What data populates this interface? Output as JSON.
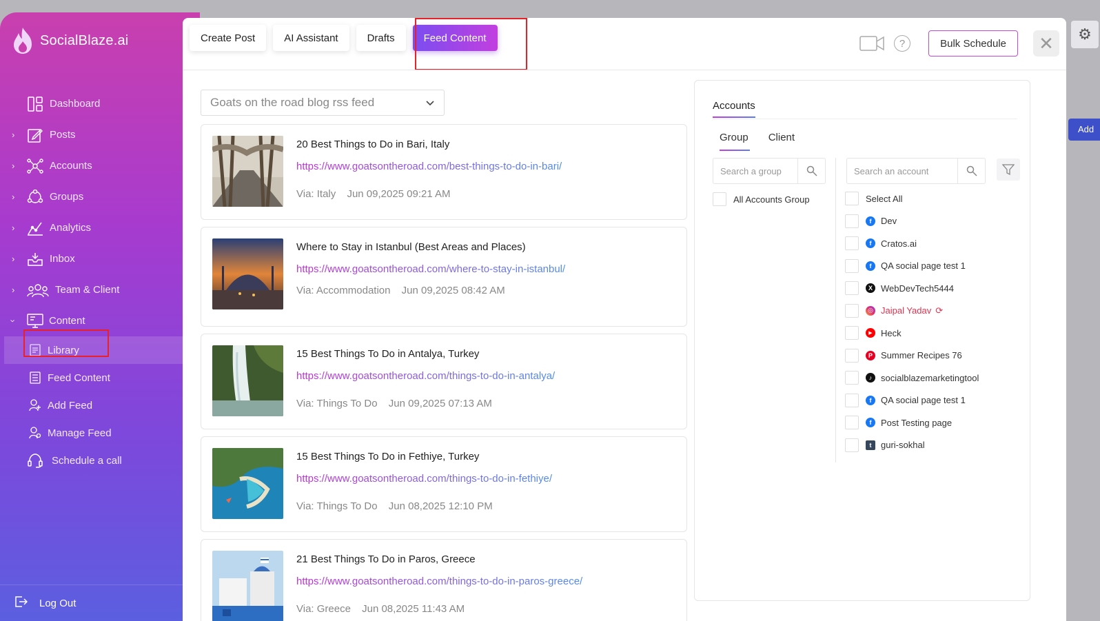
{
  "app": {
    "name": "SocialBlaze.ai"
  },
  "background": {
    "add_label": "Add"
  },
  "sidebar": {
    "items": [
      {
        "label": "Dashboard",
        "icon": "dashboard-icon",
        "chevron": false
      },
      {
        "label": "Posts",
        "icon": "edit-icon",
        "chevron": true
      },
      {
        "label": "Accounts",
        "icon": "network-icon",
        "chevron": true
      },
      {
        "label": "Groups",
        "icon": "groups-icon",
        "chevron": true
      },
      {
        "label": "Analytics",
        "icon": "analytics-icon",
        "chevron": true
      },
      {
        "label": "Inbox",
        "icon": "inbox-icon",
        "chevron": true
      },
      {
        "label": "Team & Client",
        "icon": "team-icon",
        "chevron": true
      },
      {
        "label": "Content",
        "icon": "content-icon",
        "chevron": true,
        "expanded": true
      }
    ],
    "sub_items": [
      {
        "label": "Library",
        "icon": "library-icon",
        "active": true
      },
      {
        "label": "Feed Content",
        "icon": "feed-icon"
      },
      {
        "label": "Add Feed",
        "icon": "add-user-icon"
      },
      {
        "label": "Manage Feed",
        "icon": "manage-feed-icon"
      },
      {
        "label": "Schedule a call",
        "icon": "headset-icon"
      }
    ],
    "logout": "Log Out"
  },
  "modal": {
    "tabs": [
      "Create Post",
      "AI Assistant",
      "Drafts",
      "Feed Content"
    ],
    "active_tab": "Feed Content",
    "help_glyph": "?",
    "bulk_schedule": "Bulk Schedule",
    "close_glyph": "✕"
  },
  "feed": {
    "selected": "Goats on the road blog rss feed",
    "items": [
      {
        "title": "20 Best Things to Do in Bari, Italy",
        "url": "https://www.goatsontheroad.com/best-things-to-do-in-bari/",
        "via": "Via: Italy",
        "date": "Jun 09,2025 09:21 AM"
      },
      {
        "title": "Where to Stay in Istanbul (Best Areas and Places)",
        "url": "https://www.goatsontheroad.com/where-to-stay-in-istanbul/",
        "via": "Via: Accommodation",
        "date": "Jun 09,2025 08:42 AM"
      },
      {
        "title": "15 Best Things To Do in Antalya, Turkey",
        "url": "https://www.goatsontheroad.com/things-to-do-in-antalya/",
        "via": "Via: Things To Do",
        "date": "Jun 09,2025 07:13 AM"
      },
      {
        "title": "15 Best Things To Do in Fethiye, Turkey",
        "url": "https://www.goatsontheroad.com/things-to-do-in-fethiye/",
        "via": "Via: Things To Do",
        "date": "Jun 08,2025 12:10 PM"
      },
      {
        "title": "21 Best Things To Do in Paros, Greece",
        "url": "https://www.goatsontheroad.com/things-to-do-in-paros-greece/",
        "via": "Via: Greece",
        "date": "Jun 08,2025 11:43 AM"
      }
    ]
  },
  "accounts": {
    "title": "Accounts",
    "tabs": [
      "Group",
      "Client"
    ],
    "group_search_placeholder": "Search a group",
    "account_search_placeholder": "Search an account",
    "groups": [
      "All Accounts Group"
    ],
    "select_all": "Select All",
    "list": [
      {
        "name": "Dev",
        "platform": "facebook",
        "color": "#1877f2",
        "glyph": "f"
      },
      {
        "name": "Cratos.ai",
        "platform": "facebook",
        "color": "#1877f2",
        "glyph": "f"
      },
      {
        "name": "QA social page test 1",
        "platform": "facebook",
        "color": "#1877f2",
        "glyph": "f"
      },
      {
        "name": "WebDevTech5444",
        "platform": "x",
        "color": "#111111",
        "glyph": "X"
      },
      {
        "name": "Jaipal Yadav",
        "platform": "instagram",
        "color": "#e1306c",
        "glyph": "◎",
        "warning": true
      },
      {
        "name": "Heck",
        "platform": "youtube",
        "color": "#ff0000",
        "glyph": "▶"
      },
      {
        "name": "Summer Recipes 76",
        "platform": "pinterest",
        "color": "#e60023",
        "glyph": "P"
      },
      {
        "name": "socialblazemarketingtool",
        "platform": "tiktok",
        "color": "#111111",
        "glyph": "♪"
      },
      {
        "name": "QA social page test 1",
        "platform": "facebook",
        "color": "#1877f2",
        "glyph": "f"
      },
      {
        "name": "Post Testing page",
        "platform": "facebook",
        "color": "#1877f2",
        "glyph": "f"
      },
      {
        "name": "guri-sokhal",
        "platform": "tumblr",
        "color": "#36465d",
        "glyph": "t"
      }
    ]
  }
}
